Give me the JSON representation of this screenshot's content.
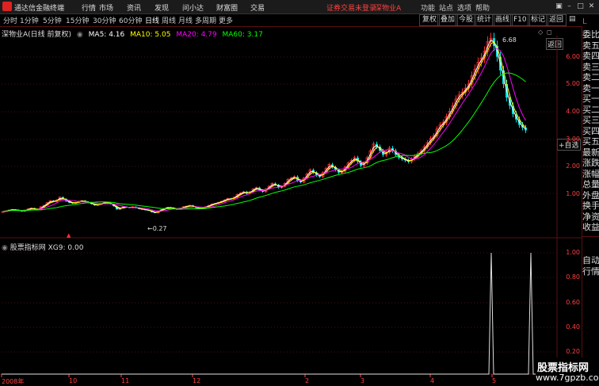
{
  "app": {
    "title": "通达信金融终端",
    "menus": [
      "行情",
      "市场",
      "资讯",
      "发现",
      "问小达",
      "财富圈",
      "交易"
    ],
    "notice": "证券交易未登录",
    "stock": "深物业A",
    "right_menus": [
      "功能",
      "站点",
      "选项",
      "帮助"
    ]
  },
  "periods": [
    "分时",
    "1分钟",
    "5分钟",
    "15分钟",
    "30分钟",
    "60分钟",
    "日线",
    "周线",
    "月线",
    "多周期",
    "更多"
  ],
  "active_period": "日线",
  "tools": [
    "复权",
    "叠加",
    "今股",
    "统计",
    "画线",
    "F10",
    "标记",
    "返回"
  ],
  "main_header": {
    "title": "深物业A(日线 前复权)",
    "ma5": "MA5: 4.16",
    "ma10": "MA10: 5.05",
    "ma20": "MA20: 4.79",
    "ma60": "MA60: 3.17"
  },
  "chart_controls": {
    "self_select": "+自选",
    "return": "返回"
  },
  "right_panel": {
    "letter": "L",
    "items": [
      "委比",
      "卖五",
      "卖四",
      "卖三",
      "卖二",
      "卖一",
      "买一",
      "买二",
      "买三",
      "买四",
      "买五",
      "最新",
      "涨跌",
      "涨幅",
      "总量",
      "外盘",
      "换手",
      "净资",
      "收益"
    ],
    "bottom_items": [
      "自动",
      "行情"
    ]
  },
  "annotations": {
    "high": "6.68",
    "low": "0.27"
  },
  "sub_header": {
    "title": "股票指标网",
    "value": "XG9: 0.00"
  },
  "colors": {
    "up": "#ff3030",
    "down": "#00e0e0",
    "ma5": "#ffffff",
    "ma10": "#ffff00",
    "ma20": "#ff00ff",
    "ma60": "#00ff00"
  },
  "chart_data": [
    {
      "type": "line",
      "title": "",
      "y_ticks": [
        "6.00",
        "5.00",
        "4.00",
        "3.00",
        "2.00",
        "1.00"
      ],
      "ylim": [
        0,
        6.9
      ],
      "x_ticks": [
        "2008年",
        "10",
        "11",
        "12",
        "2",
        "3",
        "4",
        "5"
      ],
      "x": [
        0,
        4,
        8,
        12,
        16,
        20,
        24,
        28,
        32,
        36,
        40,
        44,
        48,
        52,
        56,
        60,
        64,
        68,
        72,
        76,
        80,
        84,
        88,
        92,
        96,
        100,
        104,
        108,
        112,
        116,
        120,
        124,
        128,
        132,
        136,
        140,
        144,
        148,
        152,
        156,
        160,
        164,
        168,
        172,
        176,
        180,
        184,
        188,
        192,
        196,
        200,
        204,
        208,
        212,
        216,
        220,
        224,
        228,
        232,
        236,
        240,
        244,
        248,
        252,
        256,
        260,
        264,
        268,
        272,
        276,
        280,
        284,
        288,
        292,
        296,
        300,
        304,
        308,
        312,
        316,
        320,
        324,
        328,
        332,
        336,
        340,
        344,
        348,
        352,
        356,
        360,
        364,
        368,
        372,
        376,
        380,
        384,
        388,
        392,
        396,
        400,
        404,
        408,
        412,
        416,
        420,
        424,
        428,
        432,
        436,
        440,
        444,
        448,
        452,
        456,
        460,
        464,
        468,
        472,
        476,
        480,
        484,
        488,
        492,
        496,
        500,
        504,
        508,
        512,
        516,
        520,
        524,
        528,
        532,
        536,
        540,
        544,
        548,
        552,
        556,
        560,
        564,
        568,
        572,
        576,
        580,
        584,
        588,
        592,
        596,
        600,
        604,
        608,
        612,
        616,
        620,
        624,
        628,
        632,
        636,
        640,
        644,
        648,
        652,
        656,
        660,
        664,
        668,
        672,
        676,
        680,
        684,
        688,
        692,
        696
      ],
      "series": [
        {
          "name": "K线收盘",
          "values": [
            0.32,
            0.35,
            0.38,
            0.4,
            0.37,
            0.36,
            0.33,
            0.38,
            0.42,
            0.45,
            0.4,
            0.38,
            0.5,
            0.55,
            0.65,
            0.72,
            0.68,
            0.75,
            0.85,
            0.78,
            0.7,
            0.65,
            0.62,
            0.66,
            0.7,
            0.72,
            0.68,
            0.64,
            0.6,
            0.55,
            0.58,
            0.62,
            0.66,
            0.64,
            0.6,
            0.52,
            0.4,
            0.45,
            0.5,
            0.48,
            0.46,
            0.5,
            0.45,
            0.42,
            0.4,
            0.38,
            0.36,
            0.3,
            0.27,
            0.35,
            0.4,
            0.44,
            0.48,
            0.46,
            0.42,
            0.4,
            0.45,
            0.5,
            0.52,
            0.55,
            0.5,
            0.45,
            0.42,
            0.46,
            0.5,
            0.55,
            0.6,
            0.62,
            0.66,
            0.7,
            0.75,
            0.8,
            0.78,
            0.85,
            0.95,
            1.0,
            1.05,
            0.98,
            1.05,
            1.15,
            1.2,
            1.1,
            1.05,
            1.15,
            1.25,
            1.35,
            1.3,
            1.2,
            1.25,
            1.35,
            1.5,
            1.55,
            1.6,
            1.45,
            1.4,
            1.55,
            1.7,
            1.85,
            1.75,
            1.65,
            1.6,
            1.75,
            1.9,
            2.05,
            1.95,
            1.85,
            1.75,
            1.8,
            1.95,
            2.1,
            2.2,
            2.3,
            2.15,
            2.0,
            2.1,
            2.3,
            2.55,
            2.8,
            2.7,
            2.55,
            2.4,
            2.5,
            2.65,
            2.55,
            2.4,
            2.3,
            2.25,
            2.2,
            2.15,
            2.25,
            2.35,
            2.45,
            2.55,
            2.7,
            2.85,
            3.0,
            3.1,
            3.35,
            3.5,
            3.6,
            3.8,
            4.0,
            4.2,
            4.45,
            4.6,
            4.7,
            4.85,
            5.0,
            5.3,
            5.55,
            5.8,
            5.95,
            6.2,
            6.55,
            6.68,
            6.4,
            6.0,
            5.5,
            5.0,
            4.5,
            4.2,
            3.9,
            3.7,
            3.5,
            3.4,
            3.3
          ]
        },
        {
          "name": "MA5",
          "values": []
        },
        {
          "name": "MA10",
          "values": []
        },
        {
          "name": "MA20",
          "values": []
        },
        {
          "name": "MA60",
          "values": []
        }
      ]
    },
    {
      "type": "line",
      "title": "",
      "y_ticks": [
        "1.00",
        "0.80",
        "0.60",
        "0.40",
        "0.20"
      ],
      "ylim": [
        0,
        1.1
      ],
      "series": [
        {
          "name": "XG9",
          "spikes_at": [
            618,
            668
          ],
          "values": [
            0,
            1,
            1
          ]
        }
      ]
    }
  ],
  "watermark": {
    "line1": "股票指标网",
    "line2": "www.7gpzb.com"
  }
}
